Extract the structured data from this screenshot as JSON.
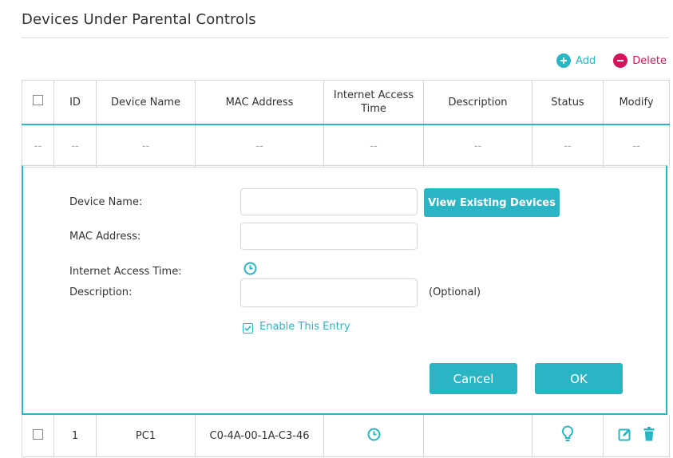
{
  "title": "Devices Under Parental Controls",
  "toolbar": {
    "add_label": "Add",
    "delete_label": "Delete"
  },
  "table": {
    "headers": {
      "id": "ID",
      "device_name": "Device Name",
      "mac": "MAC Address",
      "time_line1": "Internet Access",
      "time_line2": "Time",
      "description": "Description",
      "status": "Status",
      "modify": "Modify"
    },
    "empty_row": {
      "checkbox": "--",
      "id": "--",
      "device_name": "--",
      "mac": "--",
      "time": "--",
      "description": "--",
      "status": "--",
      "modify": "--"
    },
    "rows": [
      {
        "id": "1",
        "device_name": "PC1",
        "mac": "C0-4A-00-1A-C3-46",
        "description": ""
      }
    ]
  },
  "form": {
    "device_name_label": "Device Name:",
    "device_name_value": "",
    "view_existing_label": "View Existing Devices",
    "mac_label": "MAC Address:",
    "mac_value": "",
    "access_time_label": "Internet Access Time:",
    "description_label": "Description:",
    "description_value": "",
    "optional_label": "(Optional)",
    "enable_label": "Enable This Entry",
    "enable_checked": true,
    "cancel_label": "Cancel",
    "ok_label": "OK"
  },
  "colors": {
    "accent": "#2ab5c5",
    "danger": "#d4145a"
  },
  "icons": [
    "plus-icon",
    "minus-icon",
    "clock-icon",
    "lightbulb-icon",
    "edit-icon",
    "trash-icon",
    "checkmark-icon"
  ]
}
